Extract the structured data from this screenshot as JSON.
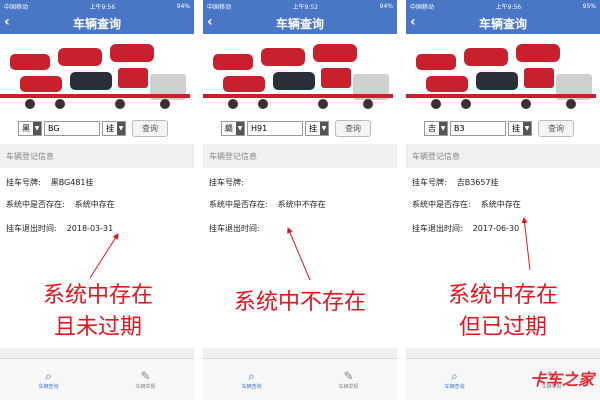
{
  "panels": [
    {
      "status": {
        "carrier": "中国移动",
        "time": "上午9:56",
        "battery": "94%"
      },
      "nav_title": "车辆查询",
      "search": {
        "province": "黑",
        "plate": "BG",
        "suffix": "挂",
        "button": "查询"
      },
      "section_title": "车辆登记信息",
      "info": [
        {
          "label": "挂车号牌:",
          "value": "黑BG481挂"
        },
        {
          "label": "系统中是否存在:",
          "value": "系统中存在"
        },
        {
          "label": "挂车退出时间:",
          "value": "2018-03-31"
        }
      ],
      "overlay": [
        "系统中存在",
        "且未过期"
      ],
      "tabs": [
        {
          "label": "车辆查询",
          "icon": "search-icon"
        },
        {
          "label": "车辆举报",
          "icon": "pen-icon"
        }
      ]
    },
    {
      "status": {
        "carrier": "中国移动",
        "time": "上午9:52",
        "battery": "94%"
      },
      "nav_title": "车辆查询",
      "search": {
        "province": "赣",
        "plate": "H91",
        "suffix": "挂",
        "button": "查询"
      },
      "section_title": "车辆登记信息",
      "info": [
        {
          "label": "挂车号牌:",
          "value": ""
        },
        {
          "label": "系统中是否存在:",
          "value": "系统中不存在"
        },
        {
          "label": "挂车退出时间:",
          "value": ""
        }
      ],
      "overlay": [
        "系统中不存在"
      ],
      "tabs": [
        {
          "label": "车辆查询",
          "icon": "search-icon"
        },
        {
          "label": "车辆举报",
          "icon": "pen-icon"
        }
      ]
    },
    {
      "status": {
        "carrier": "中国移动",
        "time": "上午9:56",
        "battery": "95%"
      },
      "nav_title": "车辆查询",
      "search": {
        "province": "吉",
        "plate": "B3",
        "suffix": "挂",
        "button": "查询"
      },
      "section_title": "车辆登记信息",
      "info": [
        {
          "label": "挂车号牌:",
          "value": "吉B3657挂"
        },
        {
          "label": "系统中是否存在:",
          "value": "系统中存在"
        },
        {
          "label": "挂车退出时间:",
          "value": "2017-06-30"
        }
      ],
      "overlay": [
        "系统中存在",
        "但已过期"
      ],
      "tabs": [
        {
          "label": "车辆查询",
          "icon": "search-icon"
        },
        {
          "label": "车辆举报",
          "icon": "pen-icon"
        }
      ]
    }
  ],
  "watermark": {
    "main": "卡车之家",
    "sub": ""
  },
  "colors": {
    "accent": "#4a76c6",
    "overlay_red": "#e6141e"
  }
}
